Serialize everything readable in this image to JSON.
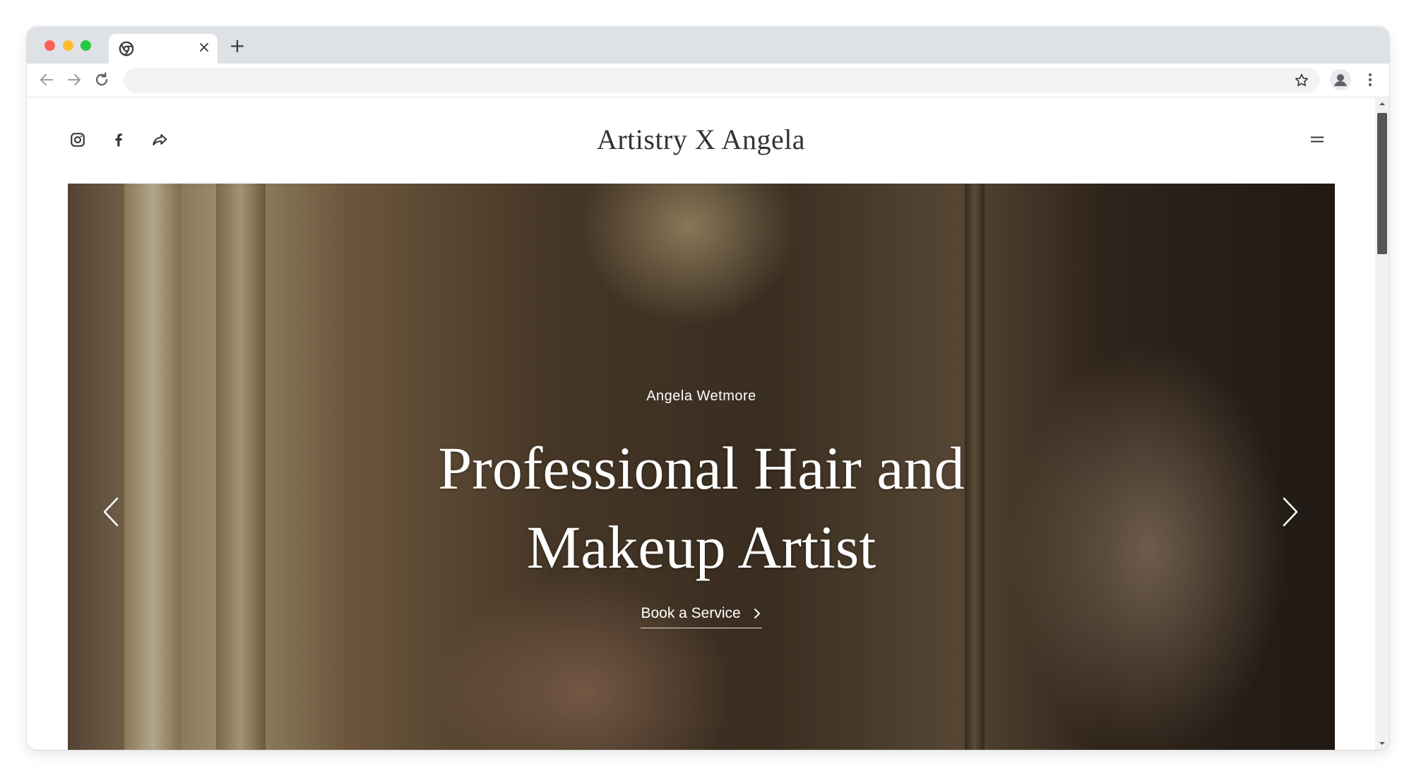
{
  "browser": {
    "tab_close_glyph": "×",
    "new_tab_glyph": "+",
    "url": ""
  },
  "site": {
    "brand": "Artistry X Angela",
    "social_icons": [
      "instagram-icon",
      "facebook-icon",
      "share-icon"
    ]
  },
  "hero": {
    "eyebrow": "Angela Wetmore",
    "title_line1": "Professional Hair and",
    "title_line2": "Makeup Artist",
    "cta_label": "Book a Service"
  },
  "colors": {
    "tabbar": "#dee1e6",
    "text_dark": "#333333",
    "hero_text": "#ffffff"
  }
}
